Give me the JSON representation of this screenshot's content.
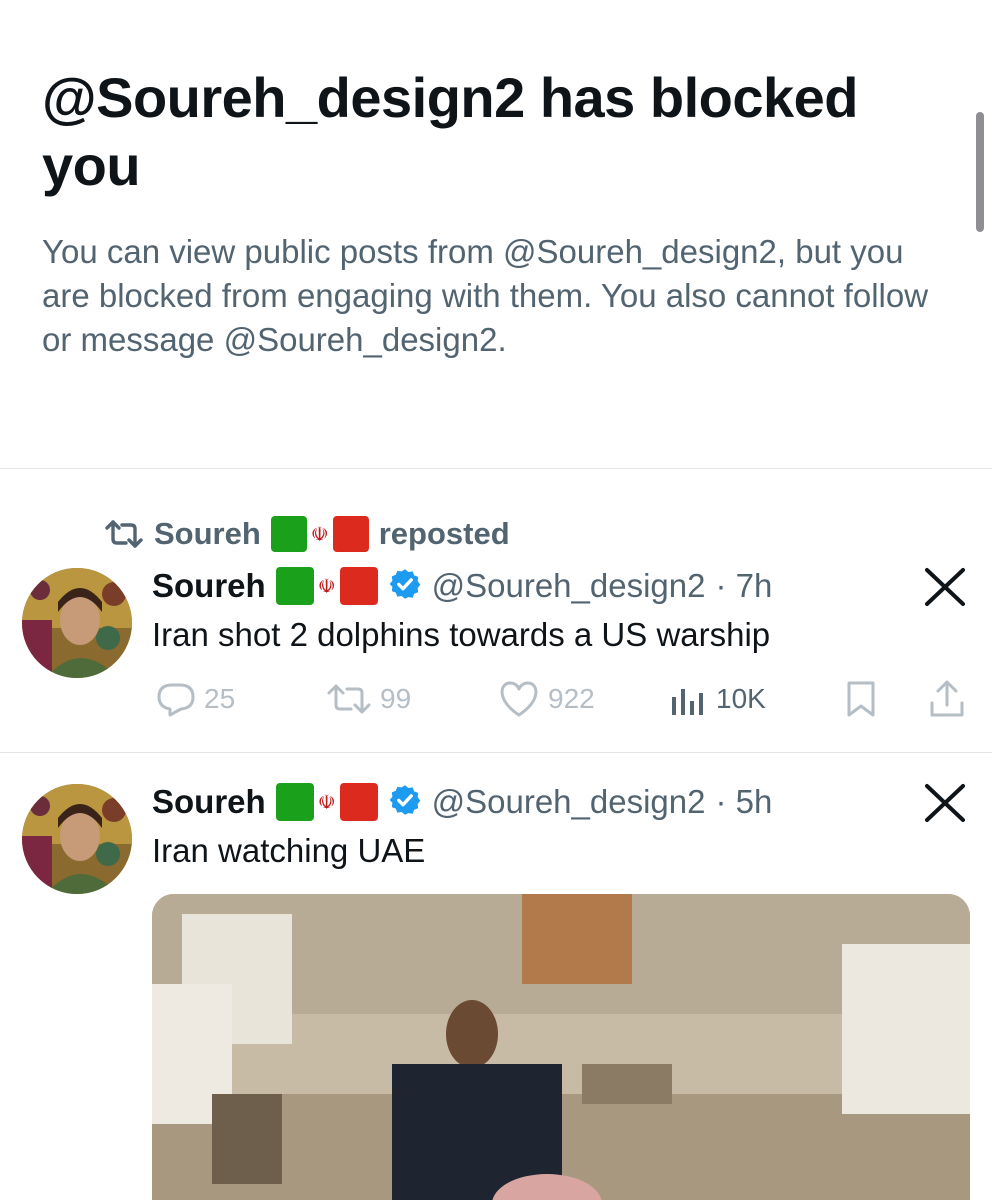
{
  "block_notice": {
    "title": "@Soureh_design2 has blocked you",
    "description": "You can view public posts from @Soureh_design2, but you are blocked from engaging with them. You also cannot follow or message @Soureh_design2."
  },
  "repost_line": {
    "icon": "repost-icon",
    "name": "Soureh",
    "flag_emblem": "☫",
    "label": "reposted"
  },
  "posts": [
    {
      "name": "Soureh",
      "flag_emblem": "☫",
      "verified_icon": "verified-badge-icon",
      "handle": "@Soureh_design2",
      "time": "· 7h",
      "text": "Iran shot 2 dolphins towards a US warship",
      "close_icon": "x-logo-icon",
      "stats": {
        "replies": "25",
        "reposts": "99",
        "likes": "922",
        "views": "10K"
      }
    },
    {
      "name": "Soureh",
      "flag_emblem": "☫",
      "verified_icon": "verified-badge-icon",
      "handle": "@Soureh_design2",
      "time": "· 5h",
      "text": "Iran watching UAE",
      "close_icon": "x-logo-icon",
      "media_icon": "post-photo"
    }
  ],
  "colors": {
    "text_primary": "#0f1419",
    "text_secondary": "#536471",
    "verified": "#1d9bf0",
    "flag_green": "#1aa01a",
    "flag_red": "#dd2a1f"
  }
}
